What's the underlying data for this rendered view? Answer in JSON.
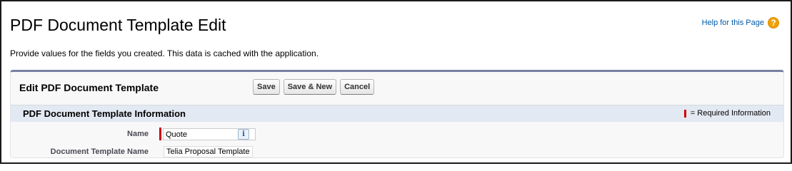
{
  "header": {
    "title": "PDF Document Template Edit",
    "help_link": "Help for this Page",
    "help_icon": "question-icon",
    "help_icon_glyph": "?"
  },
  "intro_text": "Provide values for the fields you created. This data is cached with the application.",
  "panel": {
    "title": "Edit PDF Document Template",
    "buttons": {
      "save": "Save",
      "save_new": "Save & New",
      "cancel": "Cancel"
    }
  },
  "section": {
    "title": "PDF Document Template Information",
    "required_legend": "= Required Information"
  },
  "fields": {
    "name": {
      "label": "Name",
      "value": "Quote",
      "info_glyph": "i"
    },
    "document_template_name": {
      "label": "Document Template Name",
      "value": "Telia Proposal Template"
    }
  },
  "colors": {
    "required": "#cc0000",
    "panel_border": "#777fa0",
    "section_bg": "#e3e9f2",
    "link": "#015ba7",
    "help_icon": "#f0a000"
  }
}
